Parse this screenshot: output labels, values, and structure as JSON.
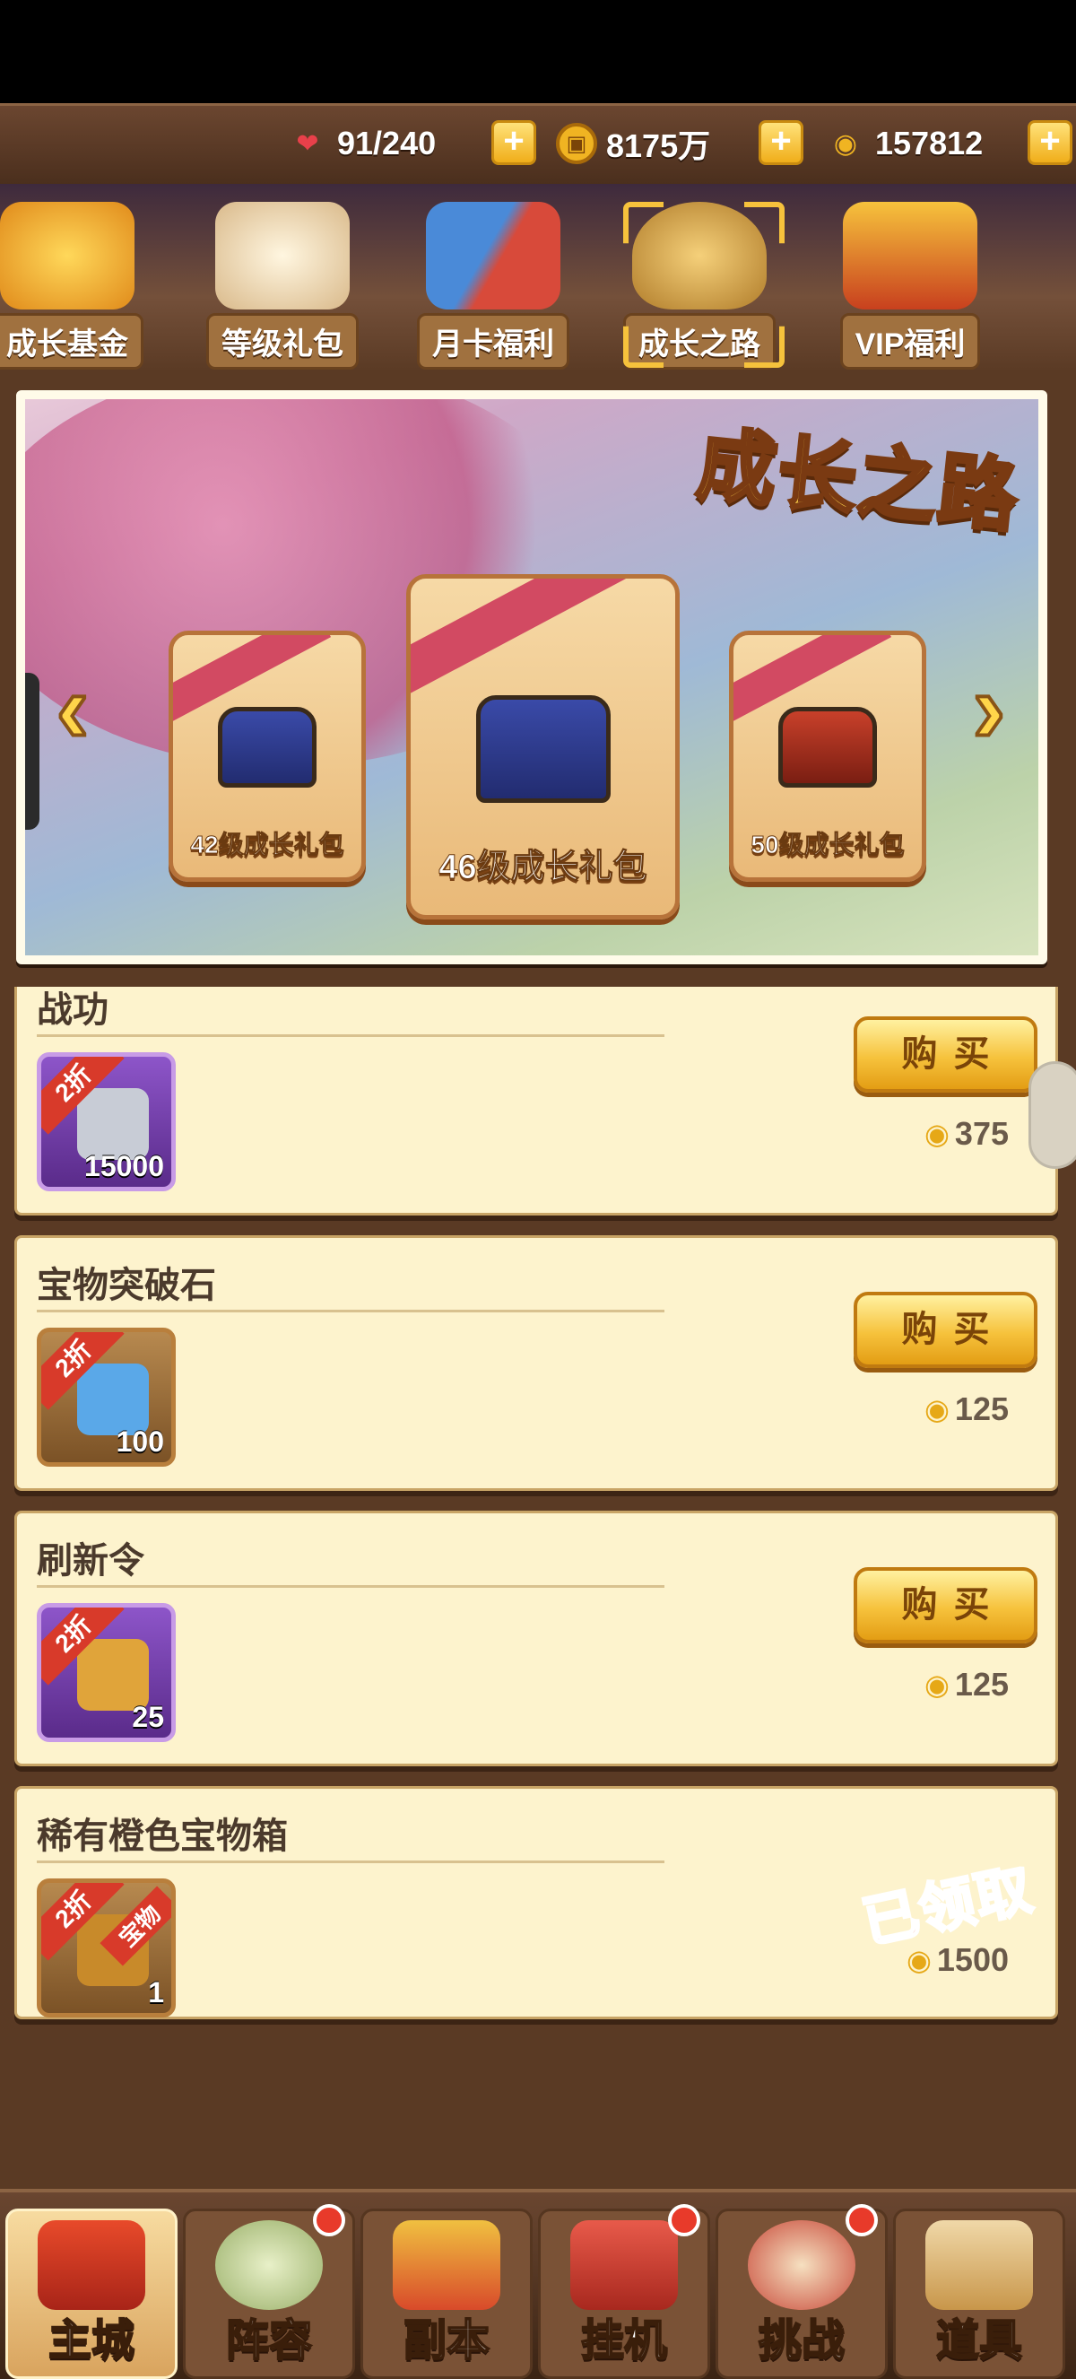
{
  "resources": {
    "stamina": "91/240",
    "coins": "8175万",
    "ingots": "157812"
  },
  "tabs": [
    {
      "label": "成长基金",
      "icon": "growth-fund-icon"
    },
    {
      "label": "等级礼包",
      "icon": "scroll-icon"
    },
    {
      "label": "月卡福利",
      "icon": "month-card-icon"
    },
    {
      "label": "成长之路",
      "icon": "straw-hat-icon",
      "active": true
    },
    {
      "label": "VIP福利",
      "icon": "vip-crown-icon"
    }
  ],
  "banner": {
    "title": "成长之路",
    "packs": [
      "42级成长礼包",
      "46级成长礼包",
      "50级成长礼包"
    ],
    "selected": "46级成长礼包"
  },
  "shop": {
    "buy_label": "购买",
    "claimed_label": "已领取",
    "items": [
      {
        "name": "战功",
        "qty": "15000",
        "discount": "2折",
        "price": "375",
        "rarity": "purple",
        "status": "buy"
      },
      {
        "name": "宝物突破石",
        "qty": "100",
        "discount": "2折",
        "price": "125",
        "rarity": "brown",
        "status": "buy"
      },
      {
        "name": "刷新令",
        "qty": "25",
        "discount": "2折",
        "price": "125",
        "rarity": "purple",
        "status": "buy"
      },
      {
        "name": "稀有橙色宝物箱",
        "qty": "1",
        "discount": "2折",
        "price": "1500",
        "rarity": "brown",
        "status": "claimed",
        "tag": "宝物"
      }
    ]
  },
  "nav": [
    {
      "label": "主城",
      "active": true
    },
    {
      "label": "阵容",
      "badge": true
    },
    {
      "label": "副本"
    },
    {
      "label": "挂机",
      "badge": true
    },
    {
      "label": "挑战",
      "badge": true
    },
    {
      "label": "道具"
    }
  ],
  "colors": {
    "gold": "#f6c23c",
    "brown_bg": "#5a3a24",
    "panel": "#fdf3cd",
    "discount": "#d83a2a"
  }
}
